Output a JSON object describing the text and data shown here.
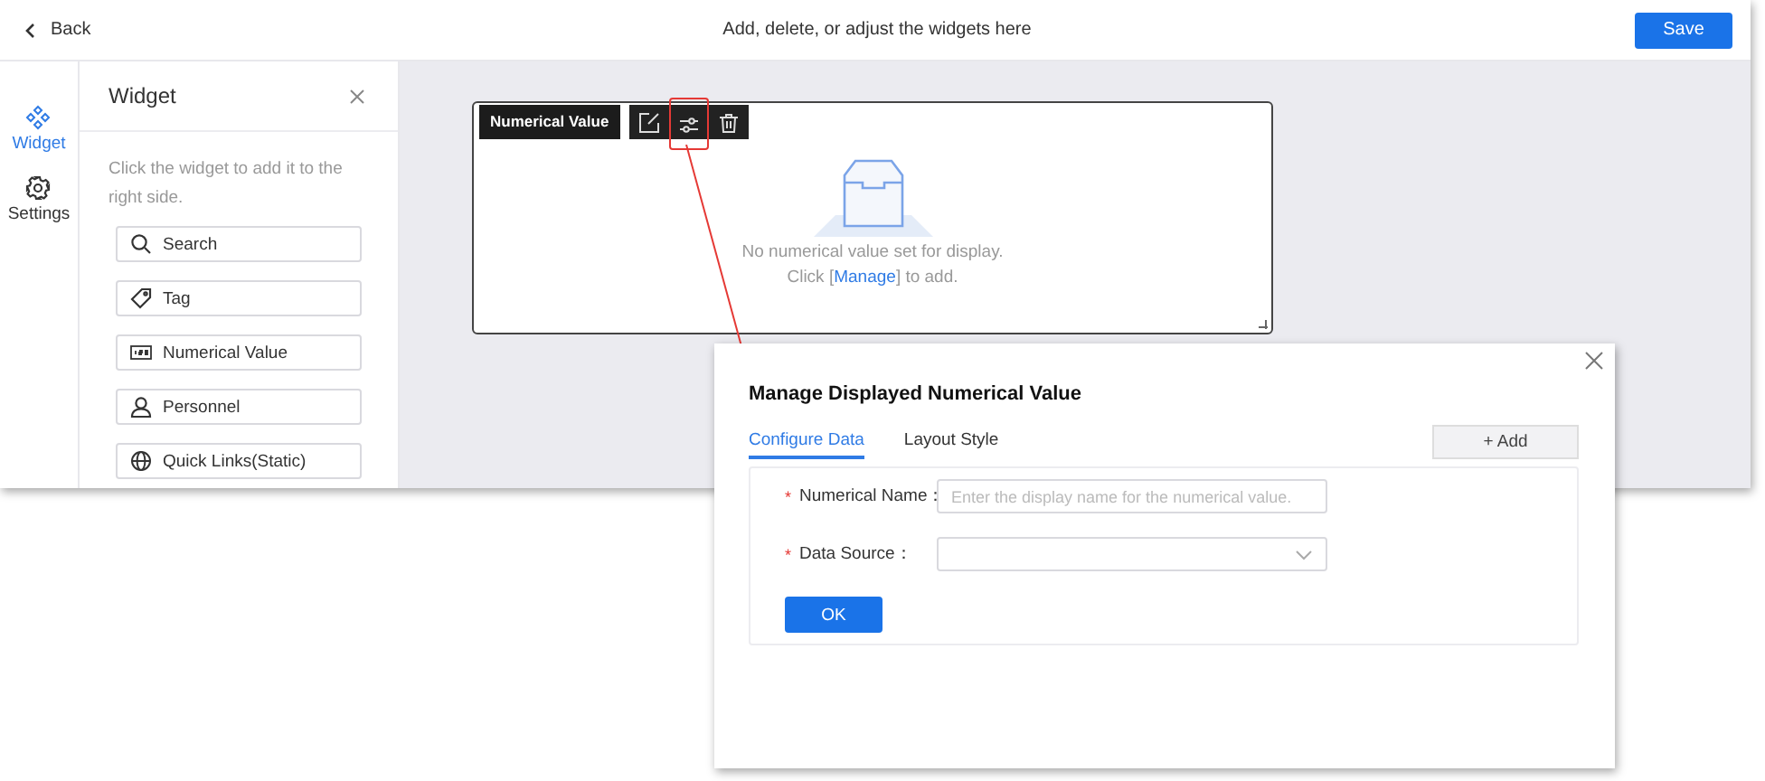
{
  "header": {
    "back": "Back",
    "title": "Add, delete, or adjust the widgets here",
    "save": "Save"
  },
  "rail": [
    {
      "label": "Widget",
      "selected": true
    },
    {
      "label": "Settings",
      "selected": false
    }
  ],
  "panel": {
    "title": "Widget",
    "hint": "Click the widget to add it to the right side.",
    "items": [
      {
        "label": "Search"
      },
      {
        "label": "Tag"
      },
      {
        "label": "Numerical Value"
      },
      {
        "label": "Personnel"
      },
      {
        "label": "Quick Links(Static)"
      }
    ]
  },
  "card": {
    "toolbar_label": "Numerical Value",
    "tools": [
      {
        "highlighted": false
      },
      {
        "highlighted": true
      },
      {
        "highlighted": false
      }
    ],
    "empty_text": "No numerical value set for display.",
    "hint_before": "Click [",
    "link": "Manage",
    "hint_after": "] to add."
  },
  "dialog": {
    "title": "Manage Displayed Numerical Value",
    "tabs": [
      {
        "label": "Configure Data",
        "selected": true
      },
      {
        "label": "Layout Style",
        "selected": false
      }
    ],
    "add": "+ Add",
    "required_mark": "*",
    "fields": [
      {
        "label": "Numerical Name：",
        "kind": "input",
        "required": true,
        "placeholder": "Enter the display name for the numerical value."
      },
      {
        "label": "Data Source：",
        "kind": "select",
        "required": true
      }
    ],
    "ok": "OK"
  }
}
